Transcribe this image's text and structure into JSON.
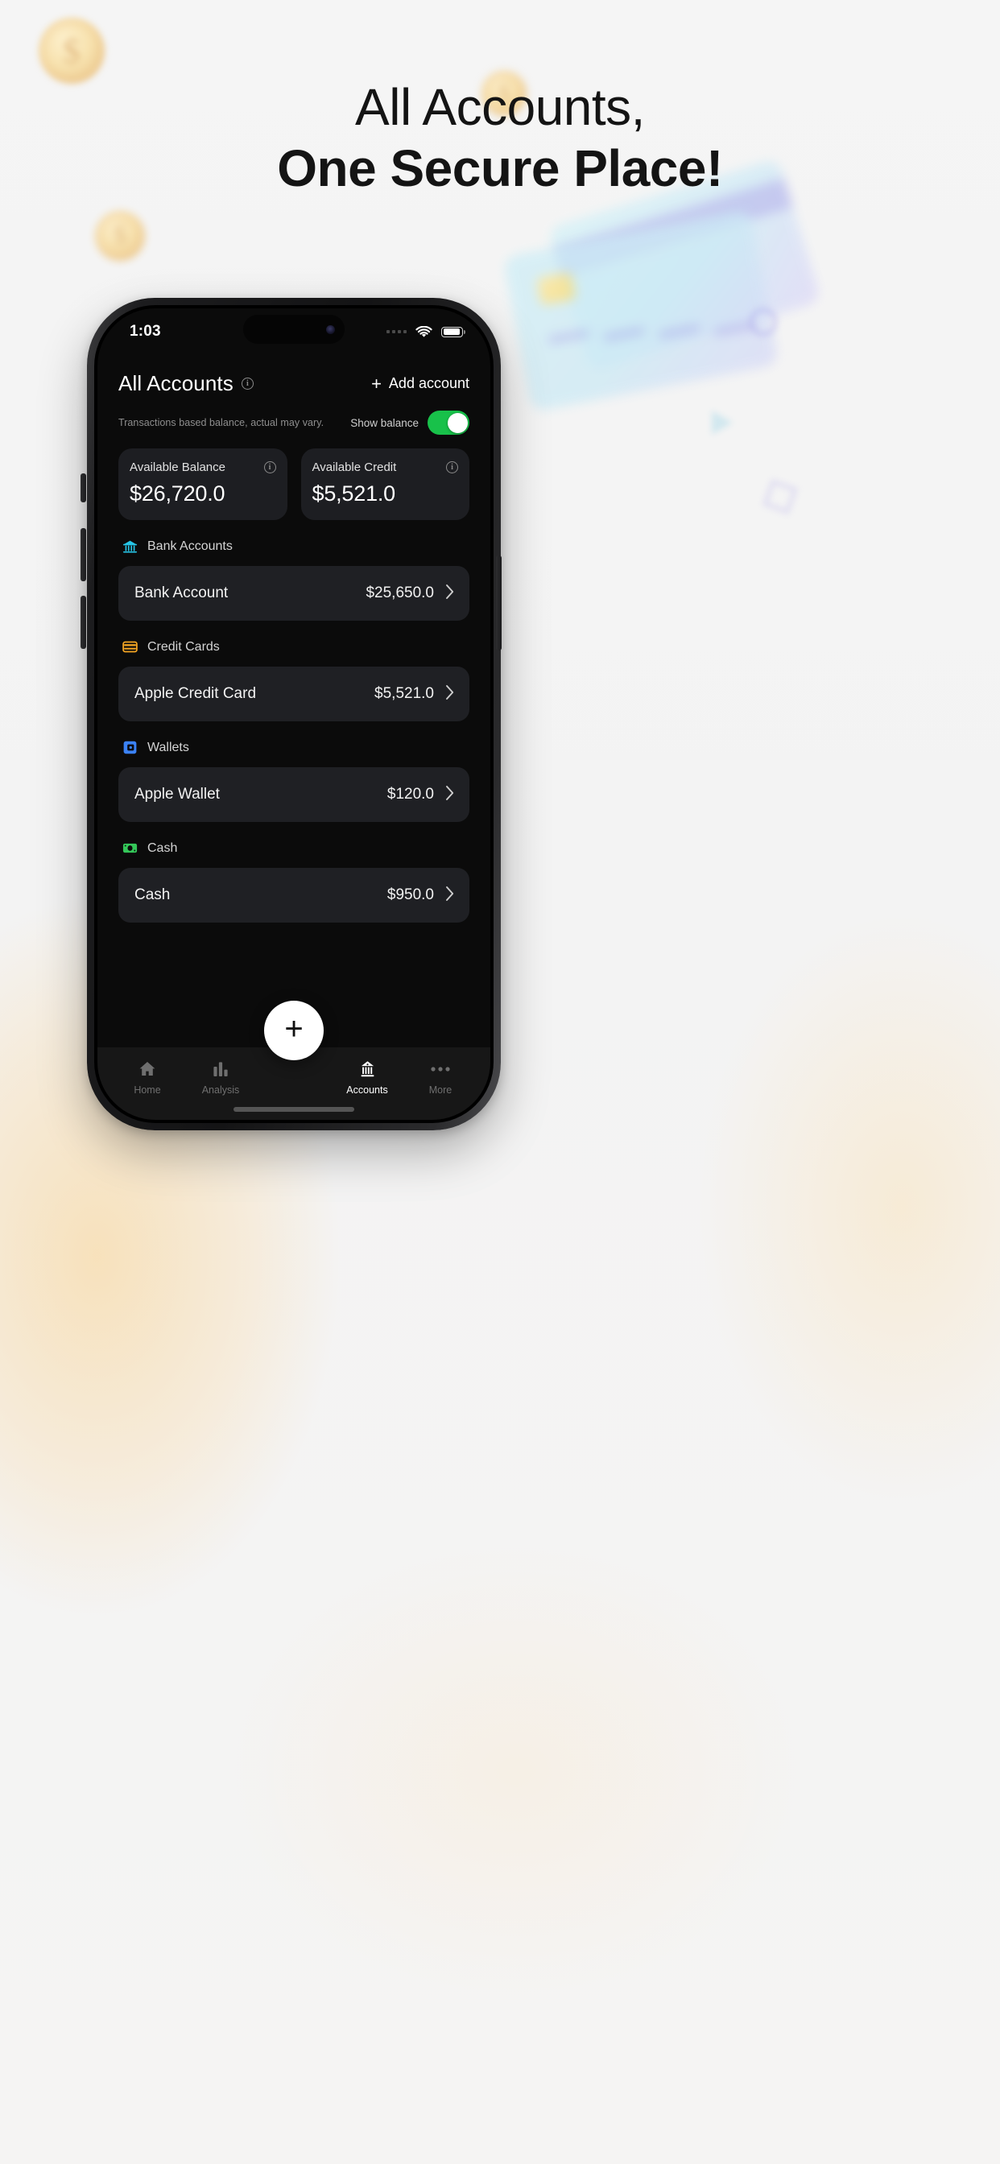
{
  "marketing": {
    "headline_line1": "All Accounts,",
    "headline_line2": "One Secure Place!"
  },
  "status_bar": {
    "time": "1:03",
    "signal_icon": "cellular-signal-icon",
    "wifi_icon": "wifi-icon",
    "battery_icon": "battery-icon"
  },
  "app": {
    "header": {
      "title": "All Accounts",
      "info_icon": "info-icon",
      "add_account_label": "Add account",
      "add_icon": "plus-icon"
    },
    "balance_note": "Transactions based balance, actual may vary.",
    "show_balance_label": "Show balance",
    "show_balance_on": true,
    "toggle_on_color": "#18c14a",
    "summary_cards": [
      {
        "label": "Available Balance",
        "value": "$26,720.0",
        "info_icon": "info-icon"
      },
      {
        "label": "Available Credit",
        "value": "$5,521.0",
        "info_icon": "info-icon"
      }
    ],
    "sections": [
      {
        "title": "Bank Accounts",
        "icon": "bank-icon",
        "icon_color": "#27c6e8",
        "rows": [
          {
            "name": "Bank Account",
            "amount": "$25,650.0",
            "chevron_icon": "chevron-right-icon"
          }
        ]
      },
      {
        "title": "Credit Cards",
        "icon": "credit-card-icon",
        "icon_color": "#f5a623",
        "rows": [
          {
            "name": "Apple Credit Card",
            "amount": "$5,521.0",
            "chevron_icon": "chevron-right-icon"
          }
        ]
      },
      {
        "title": "Wallets",
        "icon": "wallet-icon",
        "icon_color": "#3b82f6",
        "rows": [
          {
            "name": "Apple Wallet",
            "amount": "$120.0",
            "chevron_icon": "chevron-right-icon"
          }
        ]
      },
      {
        "title": "Cash",
        "icon": "cash-icon",
        "icon_color": "#34c759",
        "rows": [
          {
            "name": "Cash",
            "amount": "$950.0",
            "chevron_icon": "chevron-right-icon"
          }
        ]
      }
    ],
    "fab": {
      "label": "+",
      "icon": "plus-icon"
    },
    "tabs": [
      {
        "label": "Home",
        "icon": "home-icon",
        "active": false
      },
      {
        "label": "Analysis",
        "icon": "bar-chart-icon",
        "active": false
      },
      {
        "label": "Accounts",
        "icon": "bank-icon",
        "active": true
      },
      {
        "label": "More",
        "icon": "ellipsis-icon",
        "active": false
      }
    ]
  }
}
